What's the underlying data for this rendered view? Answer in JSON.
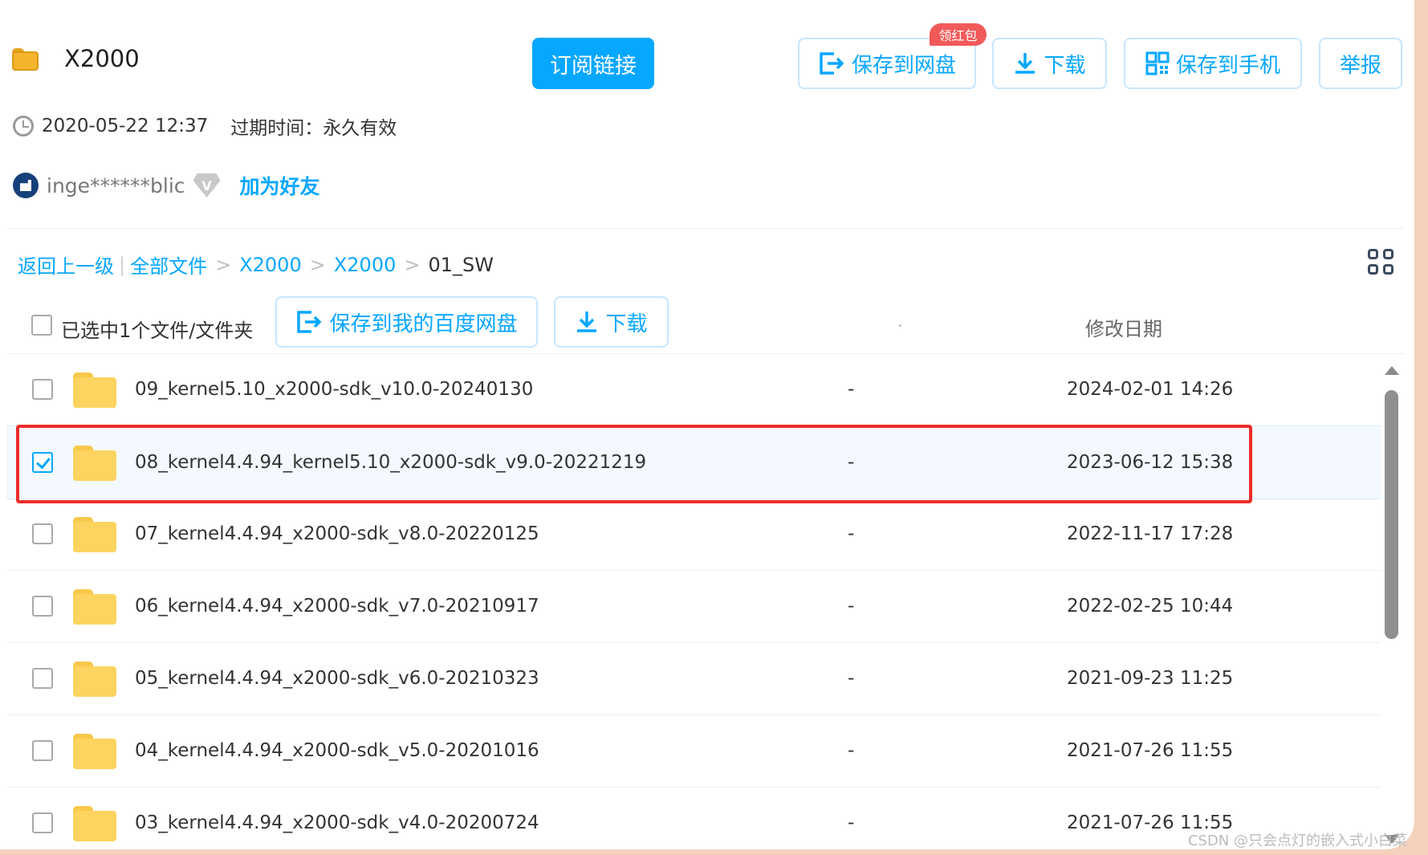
{
  "header": {
    "title": "X2000",
    "subscribe_label": "订阅链接",
    "badge": "领红包",
    "save_to_disk_label": "保存到网盘",
    "download_label": "下载",
    "save_to_phone_label": "保存到手机",
    "report_label": "举报",
    "created": "2020-05-22 12:37",
    "expiry": "过期时间：永久有效",
    "username": "inge******blic",
    "vip_letter": "V",
    "add_friend": "加为好友"
  },
  "breadcrumb": {
    "back": "返回上一级",
    "separator": "|",
    "items": [
      "全部文件",
      "X2000",
      "X2000"
    ],
    "current": "01_SW",
    "arrow": ">"
  },
  "toolbar": {
    "selected_text": "已选中1个文件/文件夹",
    "save_label": "保存到我的百度网盘",
    "download_label": "下载",
    "col_modified": "修改日期"
  },
  "files": [
    {
      "name": "09_kernel5.10_x2000-sdk_v10.0-20240130",
      "size": "-",
      "date": "2024-02-01 14:26",
      "checked": false
    },
    {
      "name": "08_kernel4.4.94_kernel5.10_x2000-sdk_v9.0-20221219",
      "size": "-",
      "date": "2023-06-12 15:38",
      "checked": true
    },
    {
      "name": "07_kernel4.4.94_x2000-sdk_v8.0-20220125",
      "size": "-",
      "date": "2022-11-17 17:28",
      "checked": false
    },
    {
      "name": "06_kernel4.4.94_x2000-sdk_v7.0-20210917",
      "size": "-",
      "date": "2022-02-25 10:44",
      "checked": false
    },
    {
      "name": "05_kernel4.4.94_x2000-sdk_v6.0-20210323",
      "size": "-",
      "date": "2021-09-23 11:25",
      "checked": false
    },
    {
      "name": "04_kernel4.4.94_x2000-sdk_v5.0-20201016",
      "size": "-",
      "date": "2021-07-26 11:55",
      "checked": false
    },
    {
      "name": "03_kernel4.4.94_x2000-sdk_v4.0-20200724",
      "size": "-",
      "date": "2021-07-26 11:55",
      "checked": false
    }
  ],
  "watermark": "CSDN @只会点灯的嵌入式小白菜",
  "colors": {
    "accent": "#06a7ff",
    "highlight": "#ef2b2b",
    "badge": "#f25a5a",
    "folder": "#fcd45f"
  }
}
